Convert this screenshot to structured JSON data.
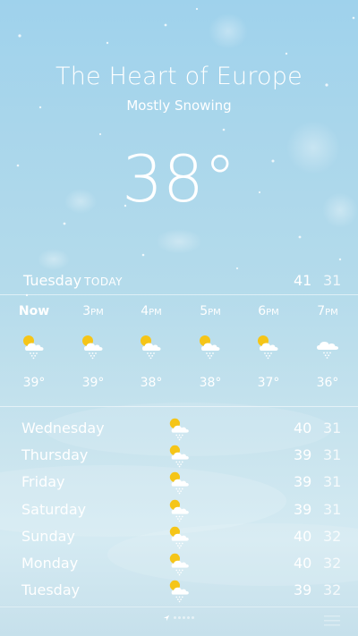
{
  "header": {
    "location": "The Heart of Europe",
    "condition": "Mostly Snowing",
    "temperature": "38°"
  },
  "today": {
    "day": "Tuesday",
    "tag": "TODAY",
    "high": "41",
    "low": "31"
  },
  "hourly": [
    {
      "label": "Now",
      "ampm": "",
      "icon": "partly-cloudy-snow-icon",
      "temp": "39°"
    },
    {
      "label": "3",
      "ampm": "PM",
      "icon": "partly-cloudy-snow-icon",
      "temp": "39°"
    },
    {
      "label": "4",
      "ampm": "PM",
      "icon": "partly-cloudy-snow-icon",
      "temp": "38°"
    },
    {
      "label": "5",
      "ampm": "PM",
      "icon": "partly-cloudy-snow-icon",
      "temp": "38°"
    },
    {
      "label": "6",
      "ampm": "PM",
      "icon": "partly-cloudy-snow-icon",
      "temp": "37°"
    },
    {
      "label": "7",
      "ampm": "PM",
      "icon": "cloudy-snow-icon",
      "temp": "36°"
    }
  ],
  "daily": [
    {
      "day": "Wednesday",
      "icon": "partly-cloudy-snow-icon",
      "high": "40",
      "low": "31"
    },
    {
      "day": "Thursday",
      "icon": "partly-cloudy-snow-icon",
      "high": "39",
      "low": "31"
    },
    {
      "day": "Friday",
      "icon": "partly-cloudy-snow-icon",
      "high": "39",
      "low": "31"
    },
    {
      "day": "Saturday",
      "icon": "partly-cloudy-snow-icon",
      "high": "39",
      "low": "31"
    },
    {
      "day": "Sunday",
      "icon": "partly-cloudy-snow-icon",
      "high": "40",
      "low": "32"
    },
    {
      "day": "Monday",
      "icon": "partly-cloudy-snow-icon",
      "high": "40",
      "low": "32"
    },
    {
      "day": "Tuesday",
      "icon": "partly-cloudy-snow-icon",
      "high": "39",
      "low": "32"
    }
  ],
  "colors": {
    "sun": "#f5c518",
    "cloud": "#ffffff",
    "text": "#ffffff"
  }
}
